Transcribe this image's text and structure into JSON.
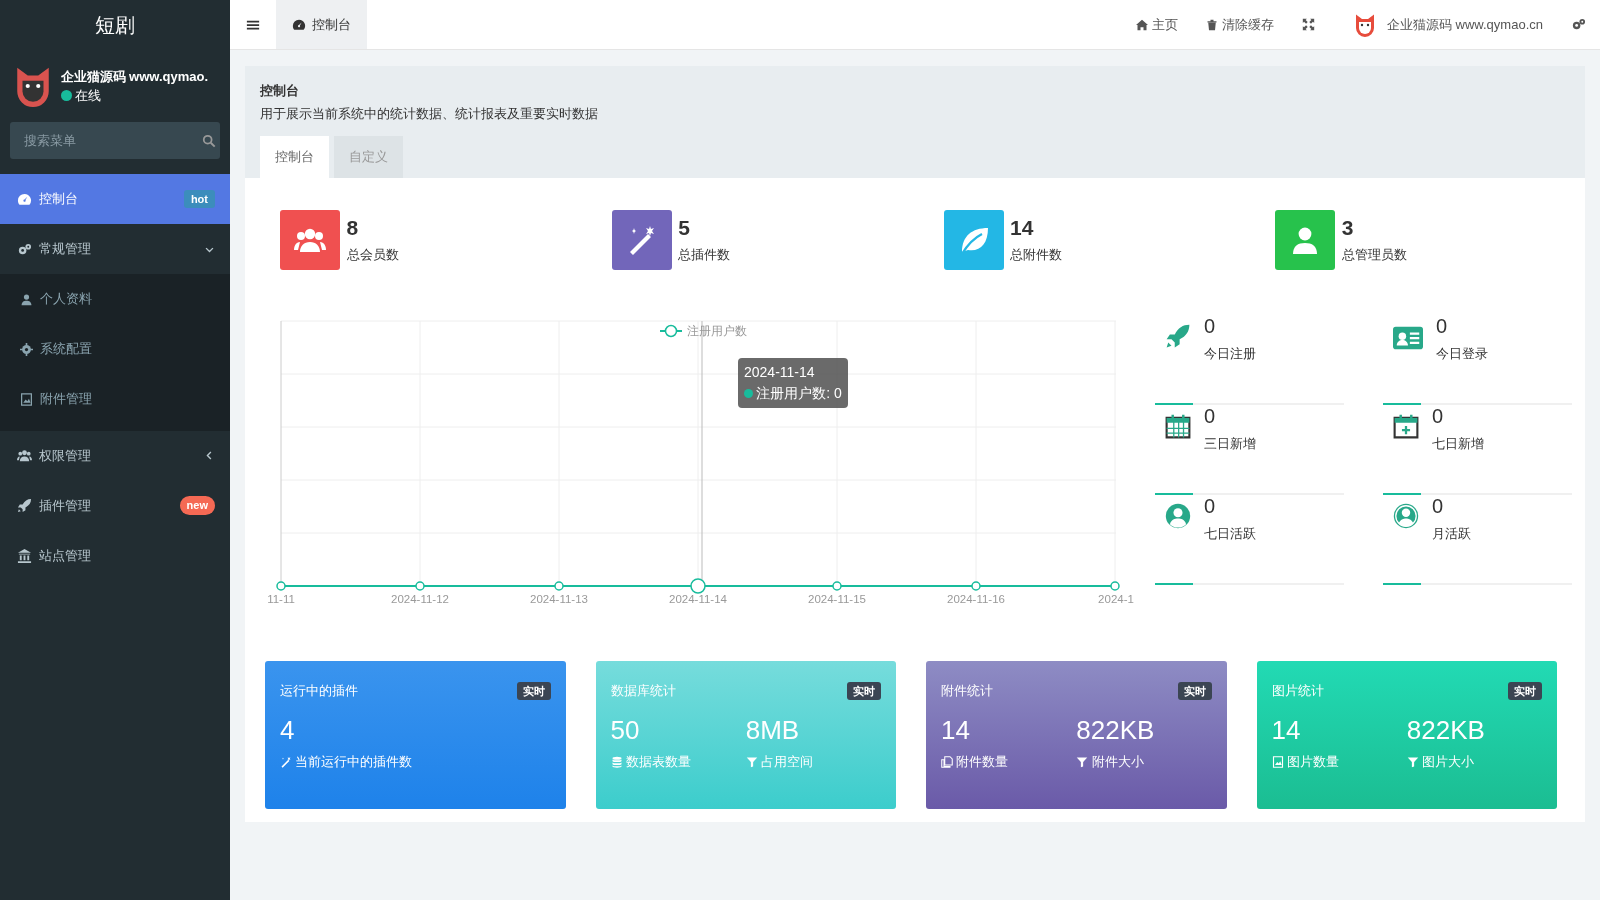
{
  "sidebar": {
    "brand": "短剧",
    "user": {
      "name": "企业猫源码 www.qymao.",
      "status": "在线",
      "online": true
    },
    "search": {
      "placeholder": "搜索菜单"
    },
    "menu": [
      {
        "label": "控制台",
        "selected": true,
        "badge": {
          "text": "hot",
          "color": "#3c8dbc"
        }
      },
      {
        "label": "常规管理",
        "selected": false,
        "expanded": true,
        "children": [
          {
            "label": "个人资料",
            "selected": false
          },
          {
            "label": "系统配置",
            "selected": false
          },
          {
            "label": "附件管理",
            "selected": false
          }
        ]
      },
      {
        "label": "权限管理",
        "selected": false,
        "expanded": false
      },
      {
        "label": "插件管理",
        "selected": false,
        "badge": {
          "text": "new",
          "color": "#f56954"
        }
      },
      {
        "label": "站点管理",
        "selected": false
      }
    ]
  },
  "header": {
    "tabs": [
      {
        "label": "控制台",
        "selected": true
      }
    ],
    "links": [
      "主页",
      "清除缓存"
    ],
    "user": "企业猫源码 www.qymao.cn"
  },
  "panel": {
    "title": "控制台",
    "description": "用于展示当前系统中的统计数据、统计报表及重要实时数据",
    "tabs": [
      {
        "label": "控制台",
        "selected": true
      },
      {
        "label": "自定义",
        "selected": false
      }
    ]
  },
  "stats": [
    {
      "value": "8",
      "label": "总会员数",
      "color": "#f05050"
    },
    {
      "value": "5",
      "label": "总插件数",
      "color": "#7266ba"
    },
    {
      "value": "14",
      "label": "总附件数",
      "color": "#23b7e5"
    },
    {
      "value": "3",
      "label": "总管理员数",
      "color": "#27c24c"
    }
  ],
  "chart": {
    "legend": "注册用户数",
    "x_labels": [
      "11-11",
      "2024-11-12",
      "2024-11-13",
      "2024-11-14",
      "2024-11-15",
      "2024-11-16",
      "2024-1"
    ],
    "tooltip": {
      "title": "2024-11-14",
      "text": "注册用户数: 0"
    }
  },
  "counters": [
    {
      "value": "0",
      "label": "今日注册"
    },
    {
      "value": "0",
      "label": "今日登录"
    },
    {
      "value": "0",
      "label": "三日新增"
    },
    {
      "value": "0",
      "label": "七日新增"
    },
    {
      "value": "0",
      "label": "七日活跃"
    },
    {
      "value": "0",
      "label": "月活跃"
    }
  ],
  "cards": [
    {
      "title": "运行中的插件",
      "badge": "实时",
      "metrics": [
        {
          "value": "4",
          "label": "当前运行中的插件数"
        }
      ]
    },
    {
      "title": "数据库统计",
      "badge": "实时",
      "metrics": [
        {
          "value": "50",
          "label": "数据表数量"
        },
        {
          "value": "8MB",
          "label": "占用空间"
        }
      ]
    },
    {
      "title": "附件统计",
      "badge": "实时",
      "metrics": [
        {
          "value": "14",
          "label": "附件数量"
        },
        {
          "value": "822KB",
          "label": "附件大小"
        }
      ]
    },
    {
      "title": "图片统计",
      "badge": "实时",
      "metrics": [
        {
          "value": "14",
          "label": "图片数量"
        },
        {
          "value": "822KB",
          "label": "图片大小"
        }
      ]
    }
  ]
}
